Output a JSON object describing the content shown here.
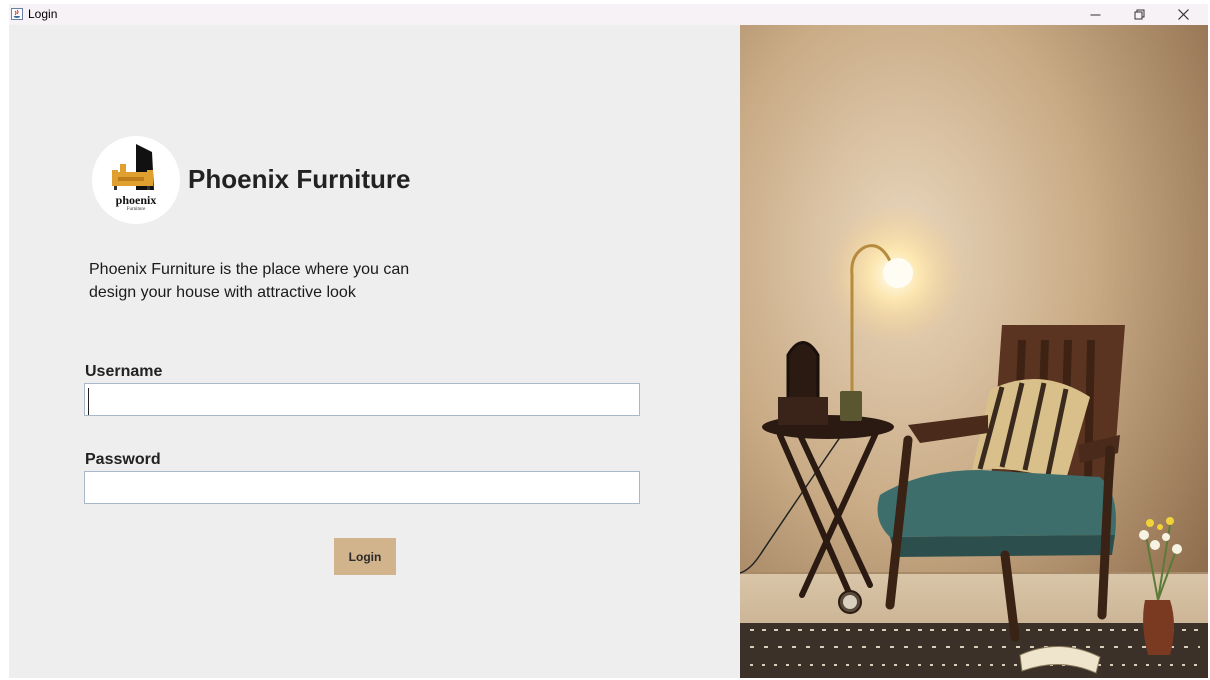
{
  "window": {
    "title": "Login",
    "controls": [
      "minimize",
      "restore",
      "close"
    ]
  },
  "brand": {
    "name": "Phoenix Furniture",
    "logo_word": "phoenix",
    "logo_sub": "Furniture",
    "logo_color": "#e0a030",
    "tagline_line1": "Phoenix Furniture is the place where you can",
    "tagline_line2": "design your house with attractive look"
  },
  "form": {
    "username_label": "Username",
    "username_value": "",
    "password_label": "Password",
    "password_value": "",
    "login_label": "Login"
  },
  "colors": {
    "panel_bg": "#eeeeee",
    "button_bg": "#d2b48c",
    "input_border": "#a9b8c9"
  },
  "photo": {
    "subject": "wooden armchair with striped cushion, side table with lamp and mirror, flowers in a vase"
  }
}
